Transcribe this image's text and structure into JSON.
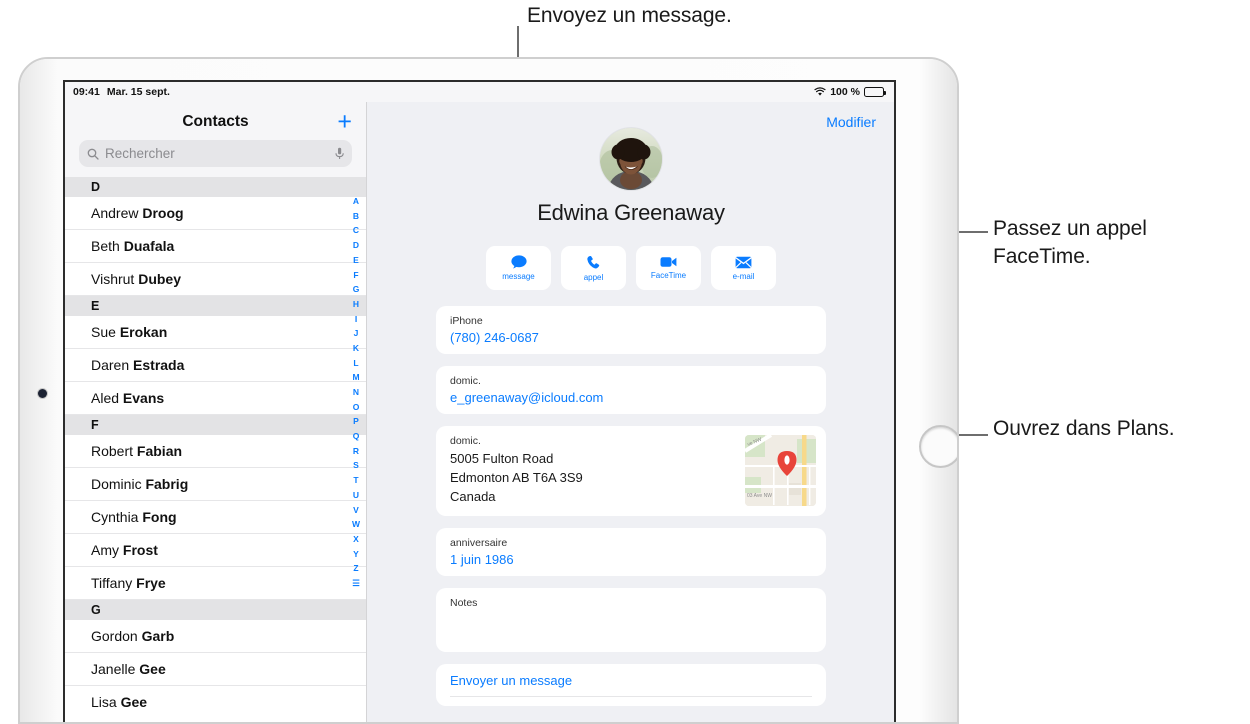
{
  "callouts": [
    {
      "id": "message",
      "text": "Envoyez un message."
    },
    {
      "id": "facetime",
      "text": "Passez un appel\nFaceTime."
    },
    {
      "id": "maps",
      "text": "Ouvrez dans Plans."
    }
  ],
  "status_bar": {
    "time": "09:41",
    "date": "Mar. 15 sept.",
    "wifi_icon": "wifi-icon",
    "battery_percent": "100 %",
    "battery_icon": "battery-full-icon"
  },
  "sidebar": {
    "title": "Contacts",
    "add_label": "+",
    "add_icon": "plus-icon",
    "search": {
      "placeholder": "Rechercher",
      "search_icon": "search-icon",
      "mic_icon": "microphone-icon"
    },
    "sections": [
      {
        "letter": "D",
        "contacts": [
          {
            "first": "Andrew ",
            "last": "Droog"
          },
          {
            "first": "Beth ",
            "last": "Duafala"
          },
          {
            "first": "Vishrut ",
            "last": "Dubey"
          }
        ]
      },
      {
        "letter": "E",
        "contacts": [
          {
            "first": "Sue ",
            "last": "Erokan"
          },
          {
            "first": "Daren ",
            "last": "Estrada"
          },
          {
            "first": "Aled ",
            "last": "Evans"
          }
        ]
      },
      {
        "letter": "F",
        "contacts": [
          {
            "first": "Robert ",
            "last": "Fabian"
          },
          {
            "first": "Dominic ",
            "last": "Fabrig"
          },
          {
            "first": "Cynthia ",
            "last": "Fong"
          },
          {
            "first": "Amy ",
            "last": "Frost"
          },
          {
            "first": "Tiffany ",
            "last": "Frye"
          }
        ]
      },
      {
        "letter": "G",
        "contacts": [
          {
            "first": "Gordon ",
            "last": "Garb"
          },
          {
            "first": "Janelle ",
            "last": "Gee"
          },
          {
            "first": "Lisa ",
            "last": "Gee"
          }
        ]
      }
    ],
    "index": [
      "A",
      "B",
      "C",
      "D",
      "E",
      "F",
      "G",
      "H",
      "I",
      "J",
      "K",
      "L",
      "M",
      "N",
      "O",
      "P",
      "Q",
      "R",
      "S",
      "T",
      "U",
      "V",
      "W",
      "X",
      "Y",
      "Z",
      "☰"
    ]
  },
  "detail": {
    "edit_label": "Modifier",
    "avatar_icon": "contact-photo",
    "name": "Edwina Greenaway",
    "actions": [
      {
        "label": "message",
        "icon": "message-bubble-icon"
      },
      {
        "label": "appel",
        "icon": "phone-icon"
      },
      {
        "label": "FaceTime",
        "icon": "video-camera-icon"
      },
      {
        "label": "e-mail",
        "icon": "envelope-icon"
      }
    ],
    "fields": {
      "phone_label": "iPhone",
      "phone_value": "(780) 246-0687",
      "email_label": "domic.",
      "email_value": "e_greenaway@icloud.com",
      "address_label": "domic.",
      "address_line1": "5005 Fulton Road",
      "address_line2": "Edmonton AB T6A 3S9",
      "address_line3": "Canada",
      "map_icon": "map-thumbnail",
      "map_street_1": "ve NW",
      "map_street_2": "03 Ave NW",
      "birthday_label": "anniversaire",
      "birthday_value": "1 juin 1986",
      "notes_label": "Notes",
      "send_message_label": "Envoyer un message"
    }
  },
  "colors": {
    "accent": "#0a7cff",
    "screen_bg": "#eff0f4",
    "section_header": "#e3e3e5",
    "pin_red": "#e8443a"
  }
}
